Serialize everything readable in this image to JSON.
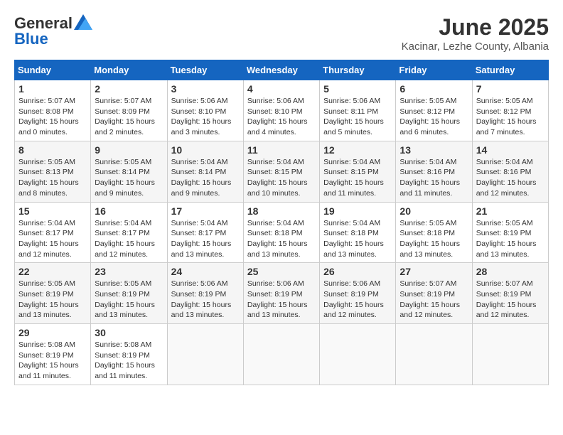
{
  "header": {
    "logo_general": "General",
    "logo_blue": "Blue",
    "main_title": "June 2025",
    "subtitle": "Kacinar, Lezhe County, Albania"
  },
  "weekdays": [
    "Sunday",
    "Monday",
    "Tuesday",
    "Wednesday",
    "Thursday",
    "Friday",
    "Saturday"
  ],
  "weeks": [
    [
      {
        "day": "1",
        "sunrise": "Sunrise: 5:07 AM",
        "sunset": "Sunset: 8:08 PM",
        "daylight": "Daylight: 15 hours and 0 minutes."
      },
      {
        "day": "2",
        "sunrise": "Sunrise: 5:07 AM",
        "sunset": "Sunset: 8:09 PM",
        "daylight": "Daylight: 15 hours and 2 minutes."
      },
      {
        "day": "3",
        "sunrise": "Sunrise: 5:06 AM",
        "sunset": "Sunset: 8:10 PM",
        "daylight": "Daylight: 15 hours and 3 minutes."
      },
      {
        "day": "4",
        "sunrise": "Sunrise: 5:06 AM",
        "sunset": "Sunset: 8:10 PM",
        "daylight": "Daylight: 15 hours and 4 minutes."
      },
      {
        "day": "5",
        "sunrise": "Sunrise: 5:06 AM",
        "sunset": "Sunset: 8:11 PM",
        "daylight": "Daylight: 15 hours and 5 minutes."
      },
      {
        "day": "6",
        "sunrise": "Sunrise: 5:05 AM",
        "sunset": "Sunset: 8:12 PM",
        "daylight": "Daylight: 15 hours and 6 minutes."
      },
      {
        "day": "7",
        "sunrise": "Sunrise: 5:05 AM",
        "sunset": "Sunset: 8:12 PM",
        "daylight": "Daylight: 15 hours and 7 minutes."
      }
    ],
    [
      {
        "day": "8",
        "sunrise": "Sunrise: 5:05 AM",
        "sunset": "Sunset: 8:13 PM",
        "daylight": "Daylight: 15 hours and 8 minutes."
      },
      {
        "day": "9",
        "sunrise": "Sunrise: 5:05 AM",
        "sunset": "Sunset: 8:14 PM",
        "daylight": "Daylight: 15 hours and 9 minutes."
      },
      {
        "day": "10",
        "sunrise": "Sunrise: 5:04 AM",
        "sunset": "Sunset: 8:14 PM",
        "daylight": "Daylight: 15 hours and 9 minutes."
      },
      {
        "day": "11",
        "sunrise": "Sunrise: 5:04 AM",
        "sunset": "Sunset: 8:15 PM",
        "daylight": "Daylight: 15 hours and 10 minutes."
      },
      {
        "day": "12",
        "sunrise": "Sunrise: 5:04 AM",
        "sunset": "Sunset: 8:15 PM",
        "daylight": "Daylight: 15 hours and 11 minutes."
      },
      {
        "day": "13",
        "sunrise": "Sunrise: 5:04 AM",
        "sunset": "Sunset: 8:16 PM",
        "daylight": "Daylight: 15 hours and 11 minutes."
      },
      {
        "day": "14",
        "sunrise": "Sunrise: 5:04 AM",
        "sunset": "Sunset: 8:16 PM",
        "daylight": "Daylight: 15 hours and 12 minutes."
      }
    ],
    [
      {
        "day": "15",
        "sunrise": "Sunrise: 5:04 AM",
        "sunset": "Sunset: 8:17 PM",
        "daylight": "Daylight: 15 hours and 12 minutes."
      },
      {
        "day": "16",
        "sunrise": "Sunrise: 5:04 AM",
        "sunset": "Sunset: 8:17 PM",
        "daylight": "Daylight: 15 hours and 12 minutes."
      },
      {
        "day": "17",
        "sunrise": "Sunrise: 5:04 AM",
        "sunset": "Sunset: 8:17 PM",
        "daylight": "Daylight: 15 hours and 13 minutes."
      },
      {
        "day": "18",
        "sunrise": "Sunrise: 5:04 AM",
        "sunset": "Sunset: 8:18 PM",
        "daylight": "Daylight: 15 hours and 13 minutes."
      },
      {
        "day": "19",
        "sunrise": "Sunrise: 5:04 AM",
        "sunset": "Sunset: 8:18 PM",
        "daylight": "Daylight: 15 hours and 13 minutes."
      },
      {
        "day": "20",
        "sunrise": "Sunrise: 5:05 AM",
        "sunset": "Sunset: 8:18 PM",
        "daylight": "Daylight: 15 hours and 13 minutes."
      },
      {
        "day": "21",
        "sunrise": "Sunrise: 5:05 AM",
        "sunset": "Sunset: 8:19 PM",
        "daylight": "Daylight: 15 hours and 13 minutes."
      }
    ],
    [
      {
        "day": "22",
        "sunrise": "Sunrise: 5:05 AM",
        "sunset": "Sunset: 8:19 PM",
        "daylight": "Daylight: 15 hours and 13 minutes."
      },
      {
        "day": "23",
        "sunrise": "Sunrise: 5:05 AM",
        "sunset": "Sunset: 8:19 PM",
        "daylight": "Daylight: 15 hours and 13 minutes."
      },
      {
        "day": "24",
        "sunrise": "Sunrise: 5:06 AM",
        "sunset": "Sunset: 8:19 PM",
        "daylight": "Daylight: 15 hours and 13 minutes."
      },
      {
        "day": "25",
        "sunrise": "Sunrise: 5:06 AM",
        "sunset": "Sunset: 8:19 PM",
        "daylight": "Daylight: 15 hours and 13 minutes."
      },
      {
        "day": "26",
        "sunrise": "Sunrise: 5:06 AM",
        "sunset": "Sunset: 8:19 PM",
        "daylight": "Daylight: 15 hours and 12 minutes."
      },
      {
        "day": "27",
        "sunrise": "Sunrise: 5:07 AM",
        "sunset": "Sunset: 8:19 PM",
        "daylight": "Daylight: 15 hours and 12 minutes."
      },
      {
        "day": "28",
        "sunrise": "Sunrise: 5:07 AM",
        "sunset": "Sunset: 8:19 PM",
        "daylight": "Daylight: 15 hours and 12 minutes."
      }
    ],
    [
      {
        "day": "29",
        "sunrise": "Sunrise: 5:08 AM",
        "sunset": "Sunset: 8:19 PM",
        "daylight": "Daylight: 15 hours and 11 minutes."
      },
      {
        "day": "30",
        "sunrise": "Sunrise: 5:08 AM",
        "sunset": "Sunset: 8:19 PM",
        "daylight": "Daylight: 15 hours and 11 minutes."
      },
      null,
      null,
      null,
      null,
      null
    ]
  ]
}
